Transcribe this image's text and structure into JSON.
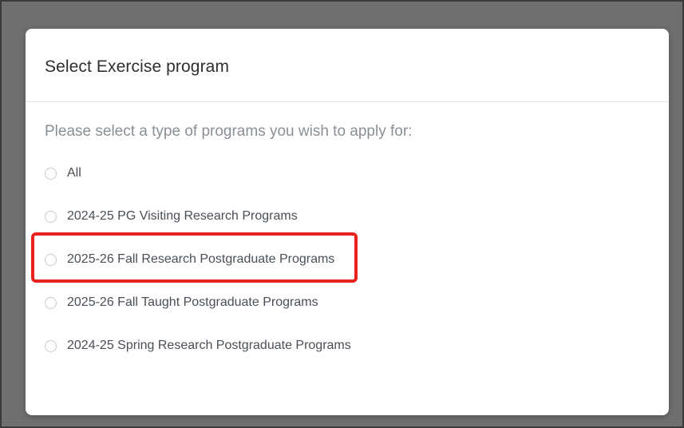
{
  "dialog": {
    "title": "Select Exercise program",
    "prompt": "Please select a type of programs you wish to apply for:",
    "options": [
      {
        "label": "All",
        "selected": false
      },
      {
        "label": "2024-25 PG Visiting Research Programs",
        "selected": false
      },
      {
        "label": "2025-26 Fall Research Postgraduate Programs",
        "selected": false,
        "highlighted": true
      },
      {
        "label": "2025-26 Fall Taught Postgraduate Programs",
        "selected": false
      },
      {
        "label": "2024-25 Spring Research Postgraduate Programs",
        "selected": false
      }
    ]
  },
  "colors": {
    "highlight_border": "#e8221c",
    "overlay": "#6f6f6f",
    "prompt_text": "#8a8f96"
  }
}
